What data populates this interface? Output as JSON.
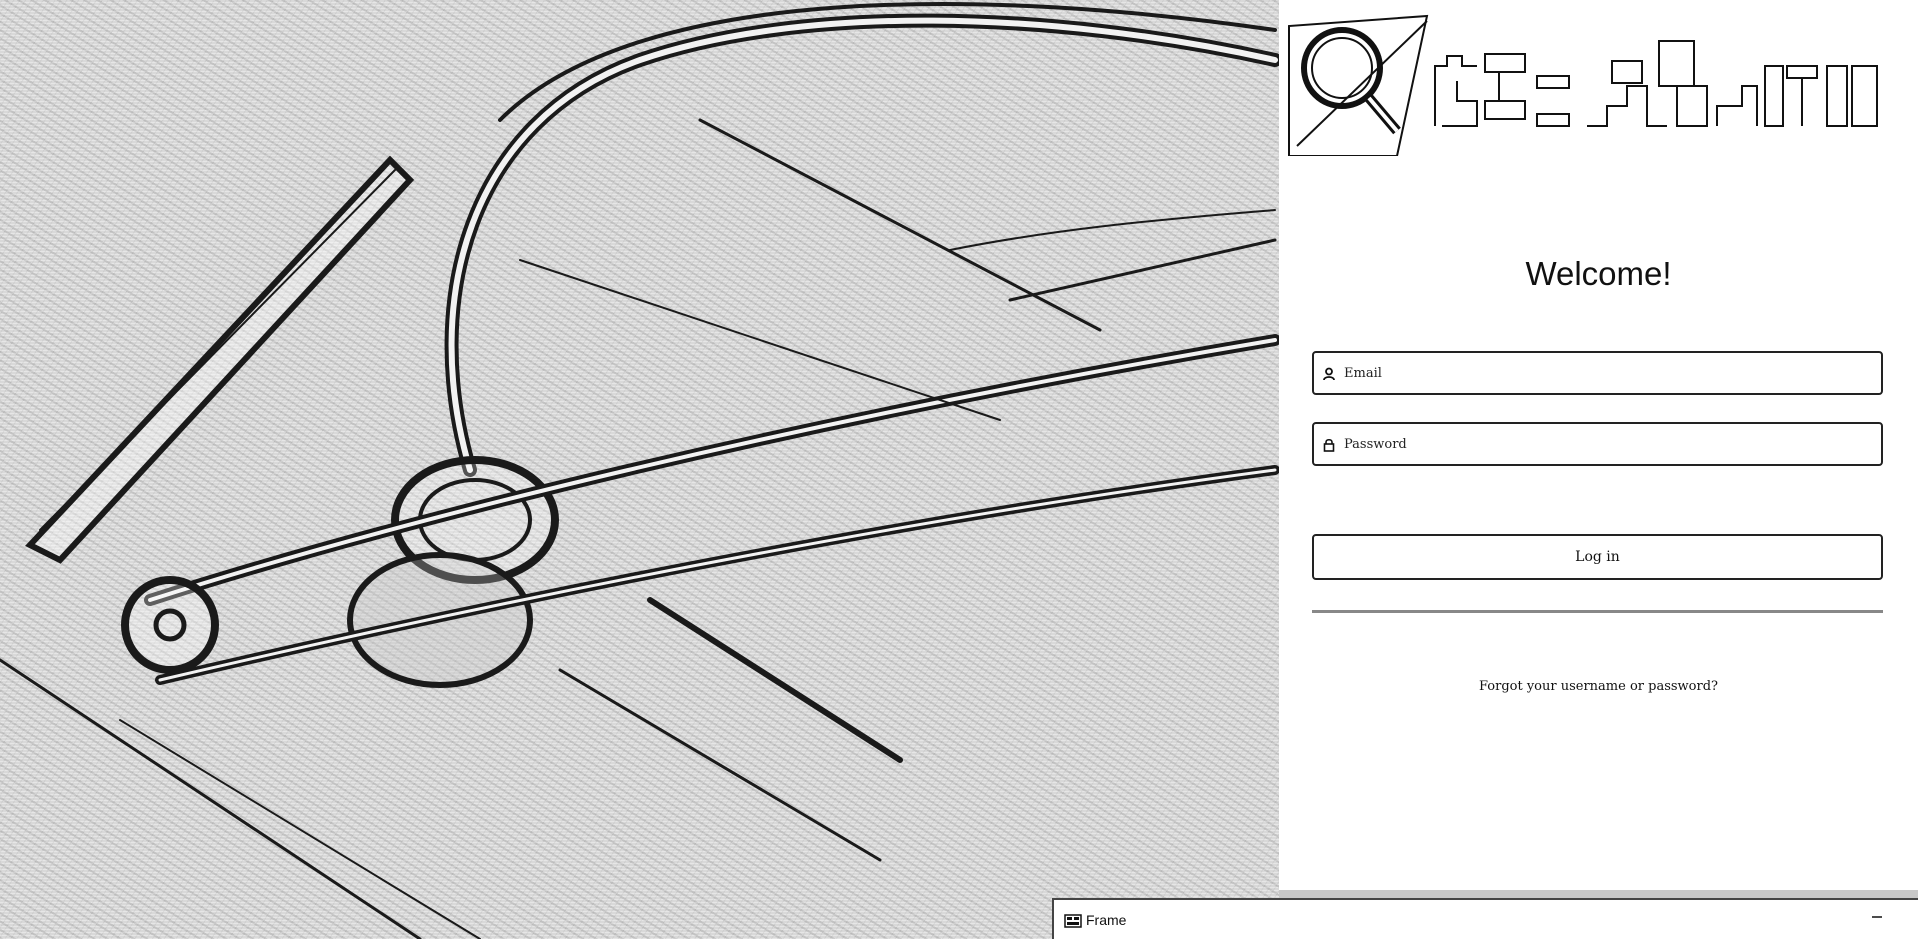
{
  "welcome": {
    "heading": "Welcome!"
  },
  "login_form": {
    "email_placeholder": "Email",
    "email_value": "",
    "password_placeholder": "Password",
    "password_value": "",
    "email_icon": "user-icon",
    "password_icon": "lock-icon",
    "login_label": "Log in",
    "forgot_label": "Forgot your username or password?"
  },
  "frame_window": {
    "title": "Frame",
    "icon": "window-icon",
    "minimize_icon": "minimize-icon"
  },
  "colors": {
    "panel_background": "#ffffff",
    "border": "#222222",
    "divider": "#888888"
  }
}
